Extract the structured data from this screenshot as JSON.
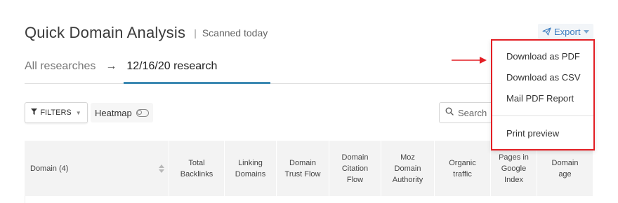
{
  "header": {
    "title": "Quick Domain Analysis",
    "separator": "|",
    "subtitle": "Scanned today",
    "export_label": "Export"
  },
  "breadcrumb": {
    "all_label": "All researches",
    "arrow": "→",
    "current_label": "12/16/20 research"
  },
  "toolbar": {
    "filters_label": "FILTERS",
    "heatmap_label": "Heatmap",
    "heatmap_on": false,
    "search_placeholder": "Search"
  },
  "table": {
    "columns": [
      {
        "line1": "Domain (4)",
        "line2": "",
        "line3": ""
      },
      {
        "line1": "Total",
        "line2": "Backlinks",
        "line3": ""
      },
      {
        "line1": "Linking",
        "line2": "Domains",
        "line3": ""
      },
      {
        "line1": "Domain",
        "line2": "Trust Flow",
        "line3": ""
      },
      {
        "line1": "Domain",
        "line2": "Citation",
        "line3": "Flow"
      },
      {
        "line1": "Moz",
        "line2": "Domain",
        "line3": "Authority"
      },
      {
        "line1": "Organic",
        "line2": "traffic",
        "line3": ""
      },
      {
        "line1": "Pages in",
        "line2": "Google",
        "line3": "Index"
      },
      {
        "line1": "Domain",
        "line2": "age",
        "line3": ""
      }
    ]
  },
  "export_menu": {
    "items": [
      "Download as PDF",
      "Download as CSV",
      "Mail PDF Report",
      "Print preview"
    ]
  },
  "colors": {
    "accent": "#3d8ab3",
    "export_text": "#3a7bbf",
    "highlight": "#e31e24"
  }
}
